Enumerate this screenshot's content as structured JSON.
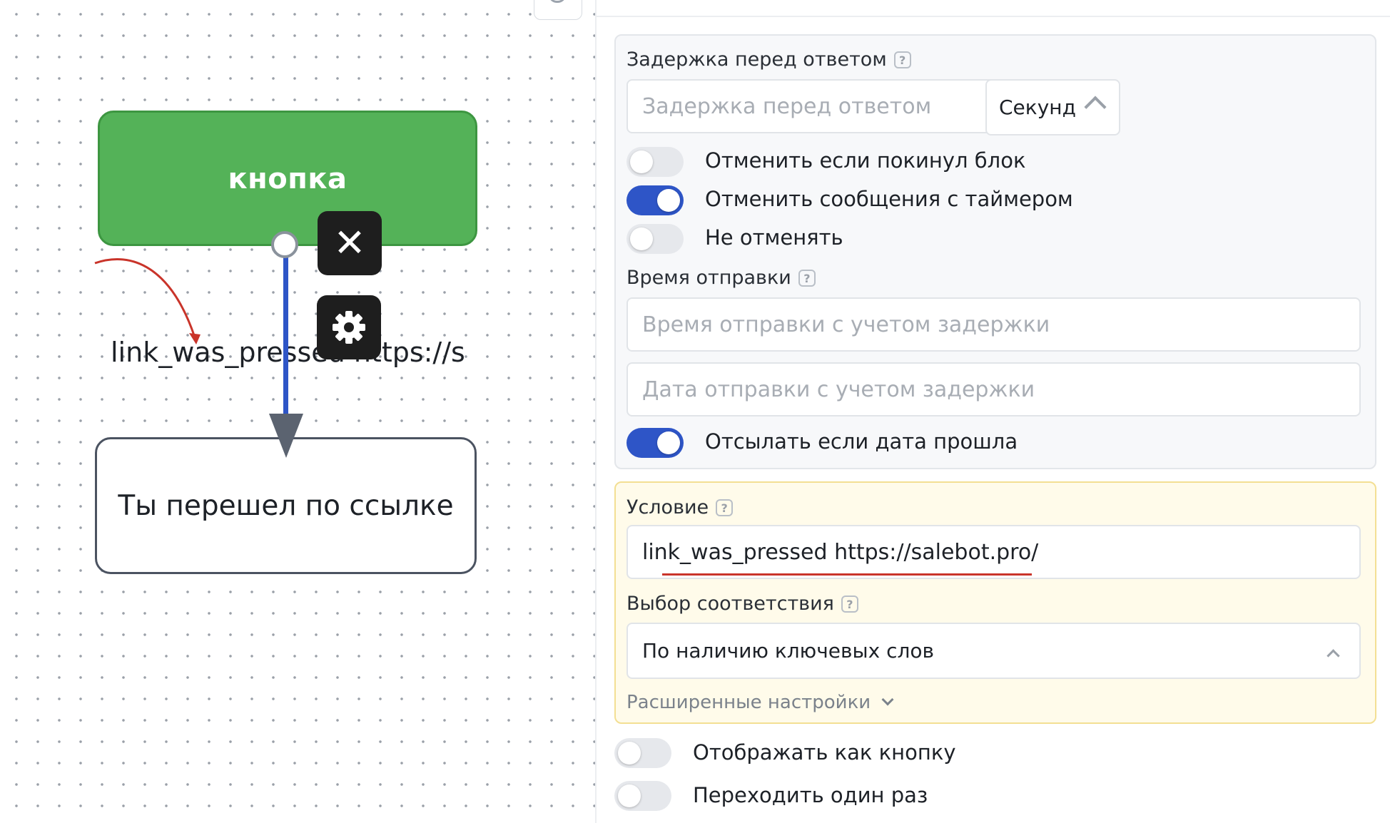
{
  "canvas": {
    "green_block_label": "кнопка",
    "connection_label": "link_was_pressed https://s",
    "white_block_label": "Ты перешел по ссылке",
    "close_glyph": "✕"
  },
  "panel": {
    "delay": {
      "label": "Задержка перед ответом",
      "help": "?",
      "input_placeholder": "Задержка перед ответом",
      "unit": "Секунд"
    },
    "toggles_top": [
      {
        "label": "Отменить если покинул блок",
        "on": false
      },
      {
        "label": "Отменить сообщения с таймером",
        "on": true
      },
      {
        "label": "Не отменять",
        "on": false
      }
    ],
    "send_time": {
      "label": "Время отправки",
      "help": "?",
      "time_placeholder": "Время отправки с учетом задержки",
      "date_placeholder": "Дата отправки с учетом задержки"
    },
    "send_if_past": {
      "label": "Отсылать если дата прошла",
      "on": true
    },
    "condition": {
      "label": "Условие",
      "help": "?",
      "value": "link_was_pressed https://salebot.pro/"
    },
    "match": {
      "label": "Выбор соответствия",
      "help": "?",
      "selected": "По наличию ключевых слов"
    },
    "advanced_label": "Расширенные настройки",
    "toggles_bottom": [
      {
        "label": "Отображать как кнопку",
        "on": false
      },
      {
        "label": "Переходить один раз",
        "on": false
      }
    ]
  },
  "colors": {
    "accent_blue": "#2e55c7",
    "block_green": "#54b258",
    "annotation_red": "#c9342a"
  },
  "icons": [
    "search-icon",
    "close-icon",
    "gear-icon",
    "help-icon",
    "chevron-up-icon",
    "chevron-down-icon"
  ]
}
